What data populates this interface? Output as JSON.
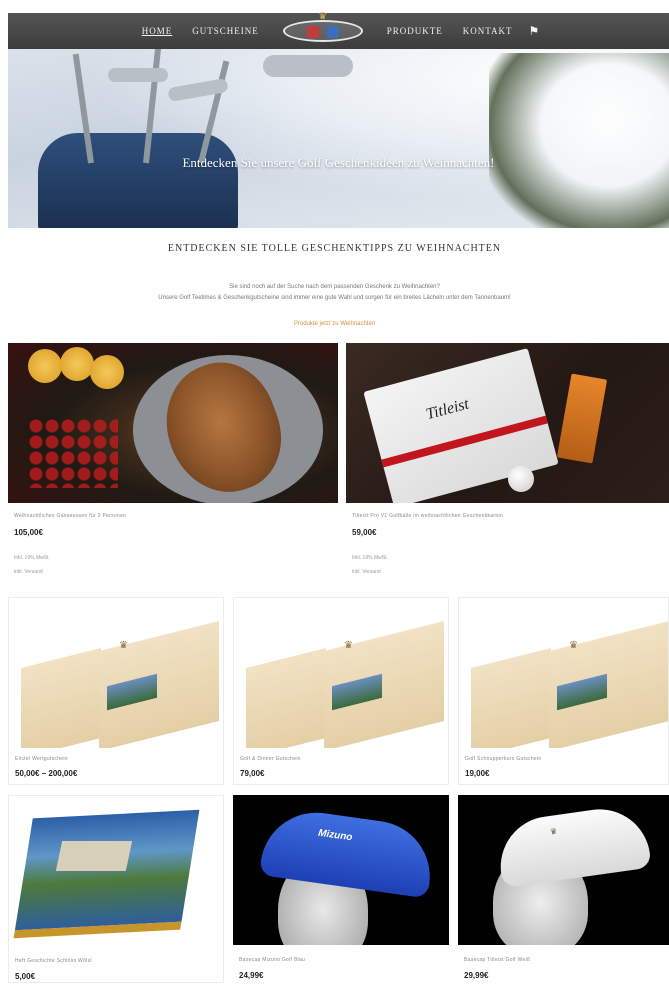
{
  "nav": {
    "items": [
      "Home",
      "Gutscheine",
      "Produkte",
      "Kontakt"
    ],
    "flag_icon": "flag-icon",
    "logo_icon": "crest-logo-icon"
  },
  "hero": {
    "title": "Entdecken Sie unsere Golf Geschenkideen zu Weihnachten!"
  },
  "intro": {
    "heading": "Entdecken Sie tolle Geschenktipps zu Weihnachten",
    "line1": "Sie sind noch auf der Suche nach dem passenden Geschenk zu Weihnachten?",
    "line2": "Unsere Golf Teetimes & Geschenkgutscheine sind immer eine gute Wahl und sorgen für ein breites Lächeln unter dem Tannenbaum!",
    "link": "Produkte jetzt zu Weihnachten"
  },
  "products": {
    "p1": {
      "name": "Weihnachtliches Gänseessen für 2 Personen",
      "price": "105,00€",
      "meta1": "Inkl. 19% MwSt.",
      "meta2": "inkl. Versand"
    },
    "p2": {
      "name": "Titleist Pro V1 Golfbälle im weihnachtlichen Geschenkkarton",
      "price": "59,00€",
      "meta1": "Inkl. 19% MwSt.",
      "meta2": "inkl. Versand"
    },
    "p3": {
      "name": "Einzel Wertgutschein",
      "price": "50,00€ – 200,00€"
    },
    "p4": {
      "name": "Golf & Dinner Gutschein",
      "price": "79,00€"
    },
    "p5": {
      "name": "Golf Schnupperkurs Gutschein",
      "price": "19,00€"
    },
    "p6": {
      "name": "Heft Geschichte Schloss Wölsl",
      "price": "5,00€"
    },
    "p7": {
      "name": "Basecap Mizuno Golf Blau",
      "price": "24,99€"
    },
    "p8": {
      "name": "Basecap Titleist Golf Weiß",
      "price": "29,99€"
    }
  },
  "colors": {
    "nav_bg": "#3c3c3c",
    "link_accent": "#c8953a"
  }
}
